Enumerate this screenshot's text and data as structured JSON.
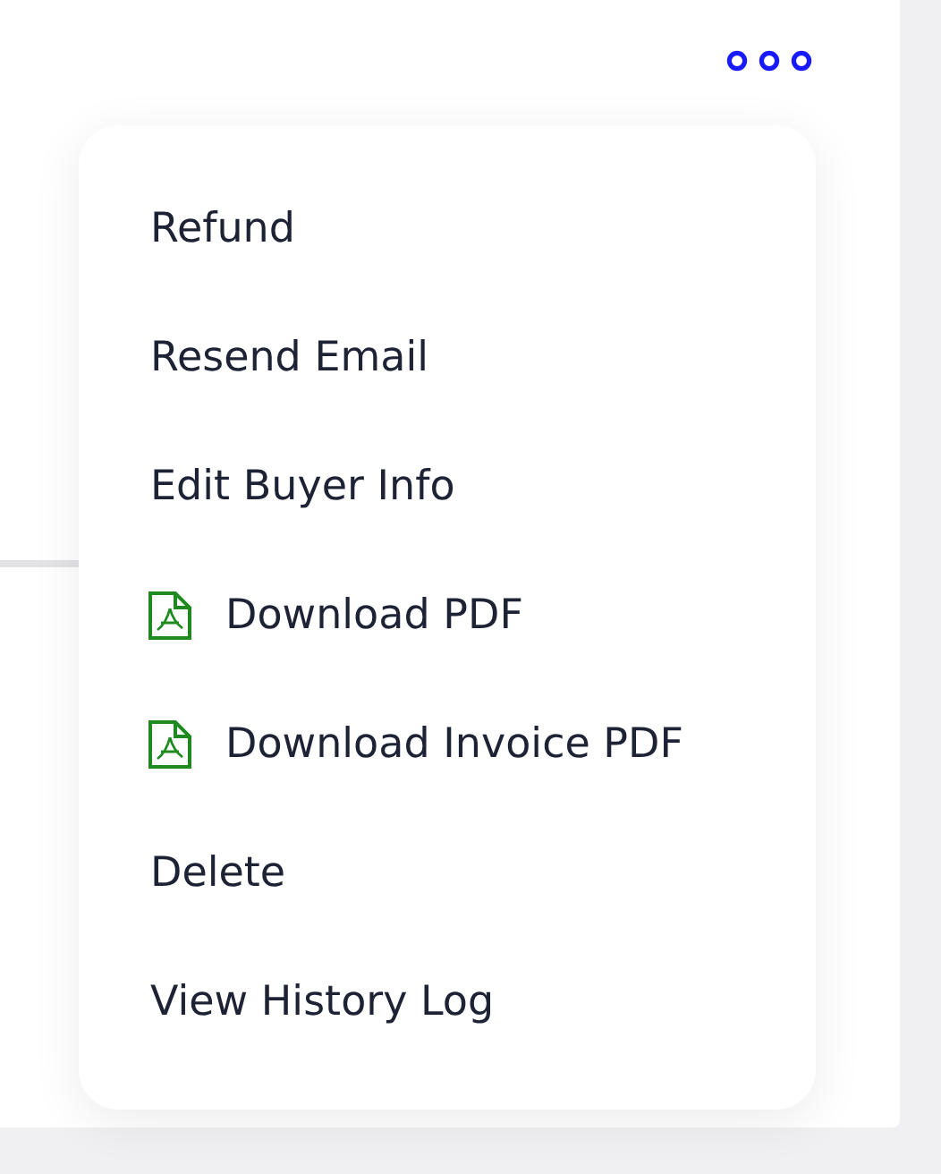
{
  "menu": {
    "items": [
      {
        "label": "Refund",
        "kind": "plain"
      },
      {
        "label": "Resend Email",
        "kind": "plain"
      },
      {
        "label": "Edit Buyer Info",
        "kind": "plain"
      },
      {
        "label": "Download PDF",
        "kind": "pdf"
      },
      {
        "label": "Download Invoice PDF",
        "kind": "pdf"
      },
      {
        "label": "Delete",
        "kind": "plain"
      },
      {
        "label": "View History Log",
        "kind": "plain"
      }
    ]
  }
}
